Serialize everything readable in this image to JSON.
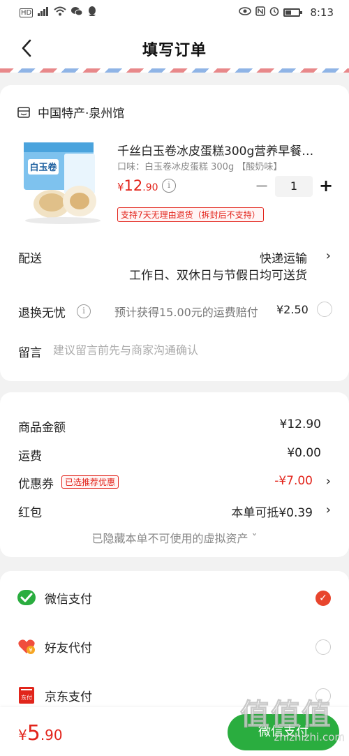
{
  "status_bar": {
    "left_icons": [
      "hd-icon",
      "signal-icon",
      "wifi-icon",
      "wechat-icon",
      "qq-icon"
    ],
    "right_icons": [
      "eye-icon",
      "nfc-icon",
      "alarm-icon",
      "battery-icon"
    ],
    "hd": "HD",
    "time": "8:13"
  },
  "header": {
    "title": "填写订单"
  },
  "shop": {
    "name": "中国特产·泉州馆"
  },
  "product": {
    "title": "千丝白玉卷冰皮蛋糕300g营养早餐…",
    "spec": "口味：白玉卷冰皮蛋糕 300g 【酸奶味】",
    "price_symbol": "¥",
    "price_int": "12",
    "price_dec": ".90",
    "quantity": "1",
    "minus": "−",
    "plus": "+",
    "return_badge": "支持7天无理由退货（拆封后不支持）",
    "image_text": "白玉卷"
  },
  "delivery": {
    "label": "配送",
    "method": "快递运输",
    "sub": "工作日、双休日与节假日均可送货",
    "chevron": "›"
  },
  "return_insurance": {
    "label": "退换无忧",
    "info": "i",
    "desc": "预计获得15.00元的运费赔付",
    "fee": "¥2.50"
  },
  "note": {
    "label": "留言",
    "placeholder": "建议留言前先与商家沟通确认"
  },
  "summary": {
    "goods_label": "商品金额",
    "goods_value": "¥12.90",
    "shipping_label": "运费",
    "shipping_value": "¥0.00",
    "coupon_label": "优惠券",
    "coupon_badge": "已选推荐优惠",
    "coupon_value": "-¥7.00",
    "red_packet_label": "红包",
    "red_packet_value": "本单可抵¥0.39",
    "hidden_assets": "已隐藏本单不可使用的虚拟资产 ˇ",
    "chevron": "›"
  },
  "payment": {
    "methods": [
      {
        "label": "微信支付",
        "icon": "wechat-pay-icon",
        "selected": true
      },
      {
        "label": "好友代付",
        "icon": "friend-pay-icon",
        "selected": false
      },
      {
        "label": "京东支付",
        "icon": "jd-pay-icon",
        "selected": false
      }
    ],
    "check": "✓"
  },
  "bottom": {
    "total_symbol": "¥",
    "total_int": "5",
    "total_dec": ".90",
    "pay_button": "微信支付"
  },
  "watermark": {
    "logo": "值值值",
    "url": "zhizhizhi.com"
  },
  "colors": {
    "accent_red": "#e2231a",
    "wechat_green": "#2aad3f",
    "check_orange": "#e8452d"
  }
}
